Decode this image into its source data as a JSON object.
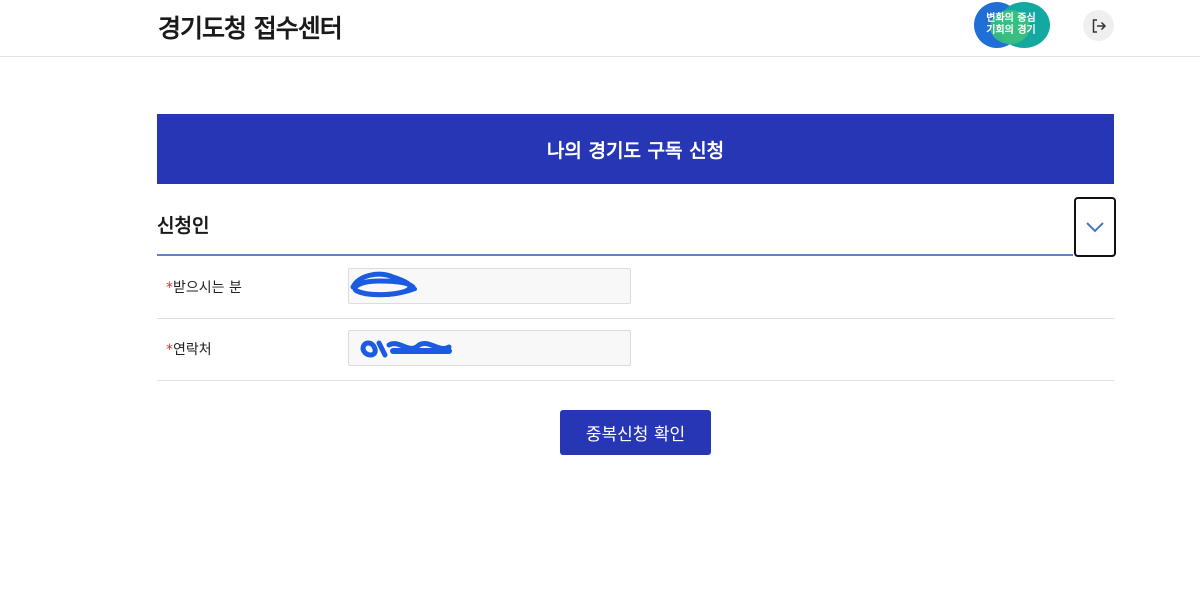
{
  "header": {
    "title": "경기도청 접수센터",
    "logo": {
      "line1": "변화의 중심",
      "line2": "기회의 경기"
    },
    "logout_icon": "logout-icon"
  },
  "banner": {
    "title": "나의 경기도 구독 신청"
  },
  "section": {
    "title": "신청인",
    "toggle_icon": "chevron-down-icon"
  },
  "form": {
    "fields": [
      {
        "required_mark": "*",
        "label": "받으시는 분",
        "value_redacted": true
      },
      {
        "required_mark": "*",
        "label": "연락처",
        "value_redacted": true
      }
    ]
  },
  "actions": {
    "check_duplicate_label": "중복신청 확인"
  },
  "colors": {
    "primary": "#2636b4",
    "required": "#d9342b",
    "redaction": "#1a5be0",
    "divider": "#5a83c0"
  }
}
